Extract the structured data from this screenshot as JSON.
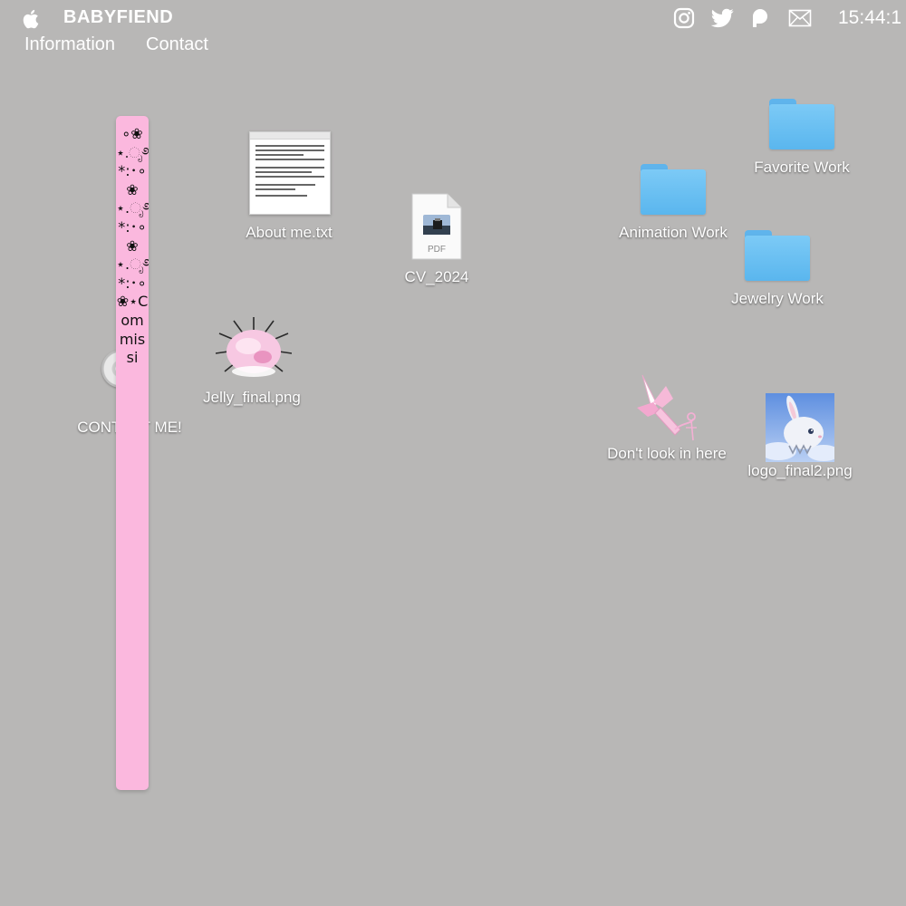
{
  "menubar": {
    "brand": "BABYFIEND",
    "items": [
      "Information",
      "Contact"
    ],
    "clock": "15:44:1",
    "status_icons": [
      "instagram-icon",
      "twitter-icon",
      "patreon-icon",
      "mail-icon"
    ]
  },
  "desktop": {
    "about": {
      "label": "About me.txt"
    },
    "cv": {
      "label": "CV_2024",
      "badge": "PDF"
    },
    "jelly": {
      "label": "Jelly_final.png"
    },
    "contact": {
      "label": "CONTACT ME!"
    },
    "favorite": {
      "label": "Favorite Work"
    },
    "animation": {
      "label": "Animation Work"
    },
    "jewelry": {
      "label": "Jewelry Work"
    },
    "dontlook": {
      "label": "Don't look in here"
    },
    "logo": {
      "label": "logo_final2.png"
    }
  },
  "commissions_bar": {
    "text": "∘❀⋆.ೃ࿔*:･∘❀⋆.ೃ࿔*:･∘❀⋆.ೃ࿔*:･∘❀⋆Commissi"
  },
  "colors": {
    "desktop_bg": "#b8b7b6",
    "pillar_pink": "#fbb8de",
    "folder_blue": "#6cc0f2"
  }
}
